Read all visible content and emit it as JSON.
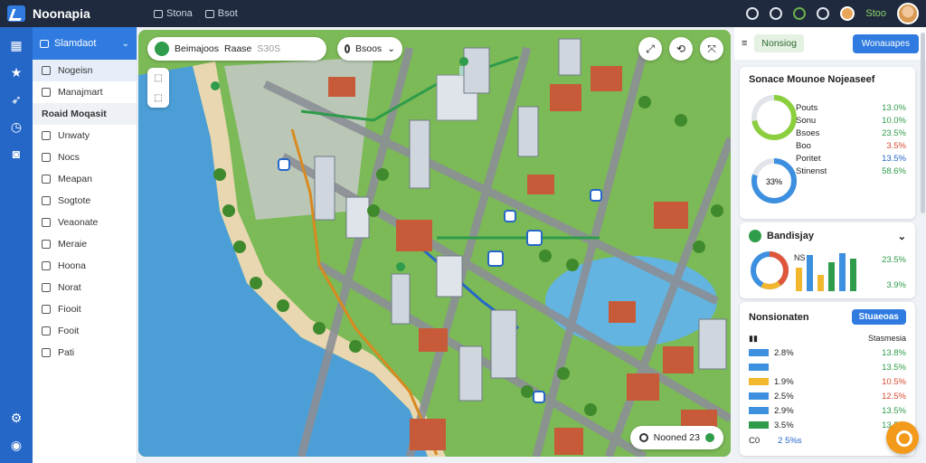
{
  "app": {
    "title": "Noonapia",
    "menu": [
      "Stona",
      "Bsot"
    ],
    "user_name": "Stoo"
  },
  "colors": {
    "accent": "#2f7be0",
    "topbar": "#1f2a3e",
    "iconbar": "#2567c7",
    "success": "#2e9c4a",
    "warning": "#f39a1b"
  },
  "icons": {
    "top": [
      "globe-icon",
      "tool-icon",
      "leaf-icon",
      "bell-icon"
    ],
    "left": [
      "dashboard-icon",
      "star-icon",
      "route-icon",
      "clock-icon",
      "camera-icon",
      "settings-icon",
      "globe-icon"
    ]
  },
  "sidebar": {
    "header": "Slamdaot",
    "items": [
      {
        "label": "Nogeisn",
        "active": true
      },
      {
        "label": "Manajmart"
      },
      {
        "label": "Roaid Moqasit",
        "group": true
      },
      {
        "label": "Unwaty"
      },
      {
        "label": "Nocs"
      },
      {
        "label": "Meapan"
      },
      {
        "label": "Sogtote"
      },
      {
        "label": "Veaonate"
      },
      {
        "label": "Meraie"
      },
      {
        "label": "Hoona"
      },
      {
        "label": "Norat"
      },
      {
        "label": "Fiooit"
      },
      {
        "label": "Fooit"
      },
      {
        "label": "Pati"
      }
    ]
  },
  "map": {
    "search": {
      "label": "Beimajoos",
      "value": "Raase",
      "count": "S30S"
    },
    "filter": "Bsoos",
    "legend": "Nooned 23",
    "tool_icons": [
      "fullscreen-icon",
      "share-icon",
      "layers-icon"
    ]
  },
  "rpanel": {
    "tab": "Nonsiog",
    "button": "Wonauapes",
    "card1": {
      "title": "Sonace Mounoe Nojeaseef",
      "rows": [
        {
          "label": "Pouts",
          "value": "13.0%"
        },
        {
          "label": "Sonu",
          "value": "10.0%"
        },
        {
          "label": "Bsoes",
          "value": "23.5%"
        },
        {
          "label": "Boo",
          "value": "3.5%"
        },
        {
          "label": "Poritet",
          "value": "13.5%"
        },
        {
          "label": "Stinenst",
          "value": "58.6%"
        }
      ],
      "donut_center": "33%"
    },
    "card2": {
      "title": "Bandisjay",
      "stats": [
        {
          "label": "NS",
          "value": "23.5%"
        },
        {
          "label": "",
          "value": "3.9%"
        }
      ]
    },
    "card3": {
      "title": "Nonsionaten",
      "button": "Stuaeoas",
      "header_right": "Stasmesia",
      "rows": [
        {
          "label": "2.8%",
          "value": "13.8%"
        },
        {
          "label": "",
          "value": "13.5%"
        },
        {
          "label": "1.9%",
          "value": "10.5%"
        },
        {
          "label": "2.5%",
          "value": "12.5%"
        },
        {
          "label": "2.9%",
          "value": "13.5%"
        },
        {
          "label": "3.5%",
          "value": "13.5%"
        }
      ],
      "footer_left": "C0",
      "footer_value": "2 5%s"
    }
  }
}
